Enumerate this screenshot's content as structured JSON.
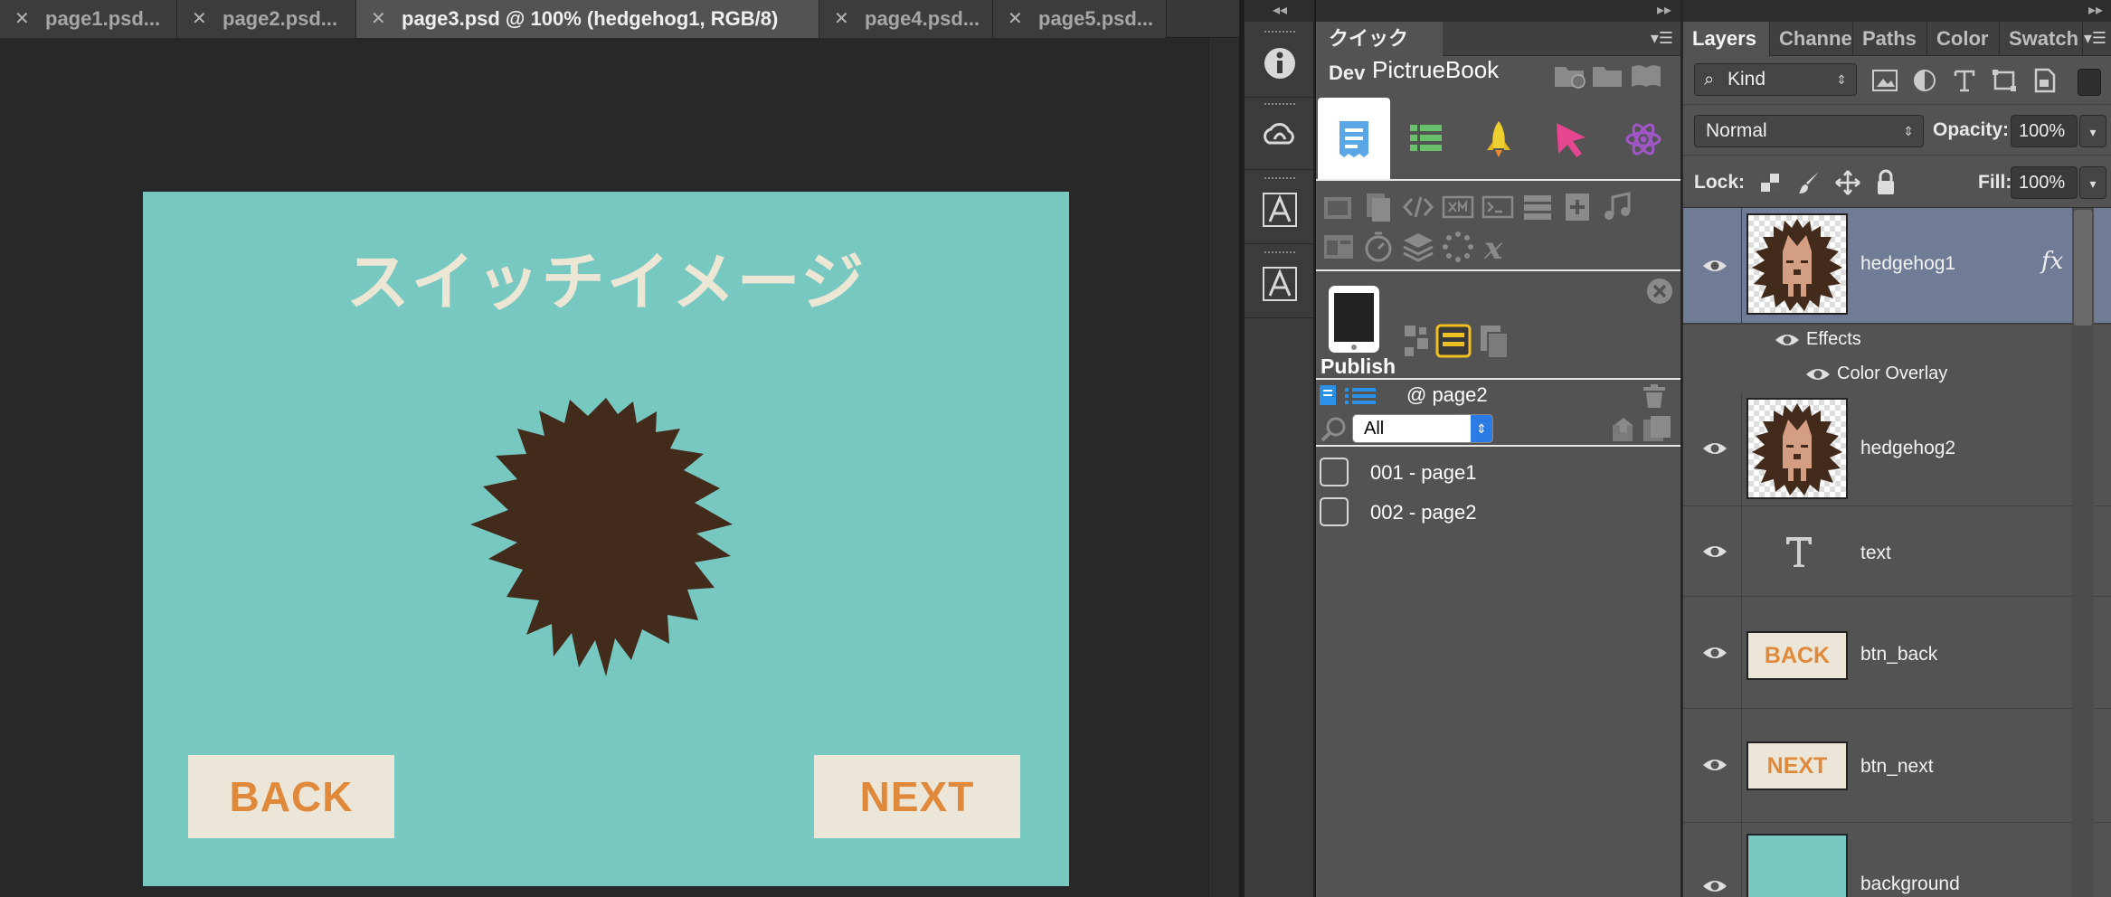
{
  "tabs": [
    {
      "label": "page1.psd...",
      "active": false
    },
    {
      "label": "page2.psd...",
      "active": false
    },
    {
      "label": "page3.psd @ 100% (hedgehog1, RGB/8)",
      "active": true
    },
    {
      "label": "page4.psd...",
      "active": false
    },
    {
      "label": "page5.psd...",
      "active": false
    }
  ],
  "canvas": {
    "title": "スイッチイメージ",
    "back_label": "BACK",
    "next_label": "NEXT",
    "colors": {
      "background": "#77c8c0",
      "hedgehog": "#432b1b",
      "button_bg": "#ece6d8",
      "button_text": "#e0893a",
      "title": "#ece6d5"
    }
  },
  "dock": {
    "collapse_glyph": "◂◂",
    "items": [
      {
        "icon": "info-icon"
      },
      {
        "icon": "creative-cloud-icon"
      },
      {
        "icon": "character-icon"
      },
      {
        "icon": "paragraph-icon"
      }
    ]
  },
  "quickdev": {
    "collapse_glyph": "▸▸",
    "tab_title": "クイック Dev",
    "title": "PictrueBook",
    "tabs": [
      {
        "icon": "document-icon",
        "selected": true
      },
      {
        "icon": "list-icon",
        "selected": false
      },
      {
        "icon": "rocket-icon",
        "selected": false
      },
      {
        "icon": "cursor-icon",
        "selected": false
      },
      {
        "icon": "atom-icon",
        "selected": false
      }
    ],
    "publish_label": "Publish",
    "current_page": "@ page2",
    "filter_value": "All",
    "pages": [
      "001 - page1",
      "002 - page2"
    ]
  },
  "layers": {
    "tabs": [
      "Layers",
      "Channe",
      "Paths",
      "Color",
      "Swatch"
    ],
    "kind_label": "Kind",
    "blend_mode": "Normal",
    "opacity_label": "Opacity:",
    "opacity_value": "100%",
    "lock_label": "Lock:",
    "fill_label": "Fill:",
    "fill_value": "100%",
    "items": [
      {
        "name": "hedgehog1",
        "selected": true,
        "has_fx": true
      },
      {
        "name": "hedgehog2",
        "selected": false
      },
      {
        "name": "text",
        "selected": false
      },
      {
        "name": "btn_back",
        "selected": false
      },
      {
        "name": "btn_next",
        "selected": false
      },
      {
        "name": "background",
        "selected": false
      }
    ],
    "effects_label": "Effects",
    "color_overlay_label": "Color Overlay",
    "fx_label": "fx"
  }
}
